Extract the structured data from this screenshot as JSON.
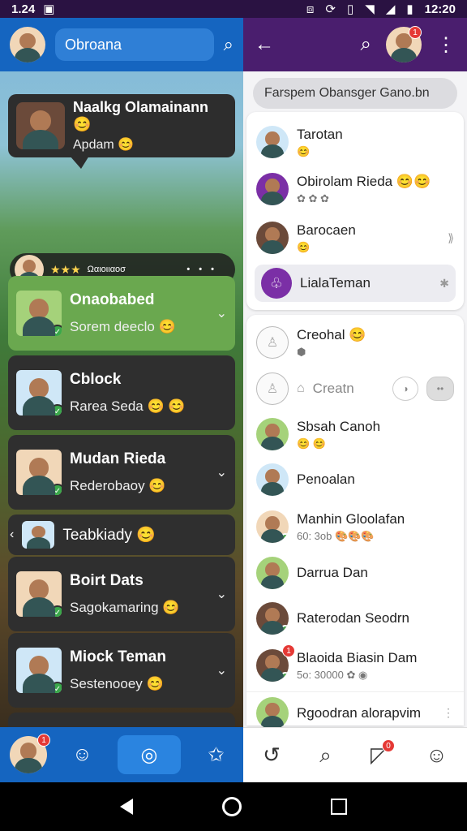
{
  "status_bar": {
    "left_time": "1.24",
    "right_time": "12:20"
  },
  "left_panel": {
    "search_label": "Obroana",
    "bubble": {
      "name": "Naalkg Olamainann 😊",
      "sub": "Apdam 😊"
    },
    "game_strip_text": "Ωαιοιιαοσ",
    "game_strip_dots": "• • •",
    "cards": [
      {
        "name": "Onaobabed",
        "sub": "Sorem deeclo 😊"
      },
      {
        "name": "Cblock",
        "sub": "Rarea Seda 😊 😊"
      },
      {
        "name": "Mudan Rieda",
        "sub": "Rederobaoy 😊"
      },
      {
        "name": "Teabkiady 😊",
        "sub": ""
      },
      {
        "name": "Boirt Dats",
        "sub": "Sagokamaring 😊"
      },
      {
        "name": "Miock Teman",
        "sub": "Sestenooey 😊"
      }
    ],
    "nav_badge": "1"
  },
  "right_panel": {
    "search_placeholder": "Farspem Obansger Gano.bn",
    "header_badge": "1",
    "contacts_top": [
      {
        "name": "Tarotan",
        "sub": "😊"
      },
      {
        "name": "Obirolam Rieda 😊😊",
        "sub": "✿ ✿ ✿"
      },
      {
        "name": "Barocaen",
        "sub": "😊",
        "end": "⟫"
      },
      {
        "name": "LialaTeman",
        "sub": "",
        "end": "✱"
      }
    ],
    "contacts_bottom": [
      {
        "name": "Creohal 😊",
        "sub": "⬢"
      },
      {
        "name": "Creatn",
        "sub": ""
      },
      {
        "name": "Sbsah Canoh",
        "sub": "😊 😊"
      },
      {
        "name": "Penoalan",
        "sub": ""
      },
      {
        "name": "Manhin Gloolafan",
        "sub": "60: 3ob 🎨🎨🎨"
      },
      {
        "name": "Darrua Dan",
        "sub": ""
      },
      {
        "name": "Raterodan Seodrn",
        "sub": ""
      },
      {
        "name": "Blaoida Biasin Dam",
        "sub": "5o: 30000 ✿ ◉"
      },
      {
        "name": "Rgoodran alorapvim",
        "sub": "",
        "end": "⋮"
      }
    ],
    "nav_badge": "0"
  },
  "icons": {
    "search": "search-icon",
    "back": "back-arrow-icon",
    "more": "more-vert-icon",
    "emoji": "emoji-icon",
    "chat": "chat-icon",
    "star": "star-icon"
  },
  "colors": {
    "left_header": "#1565c0",
    "right_header": "#4a1e6e",
    "active_card": "#6aa84f"
  }
}
